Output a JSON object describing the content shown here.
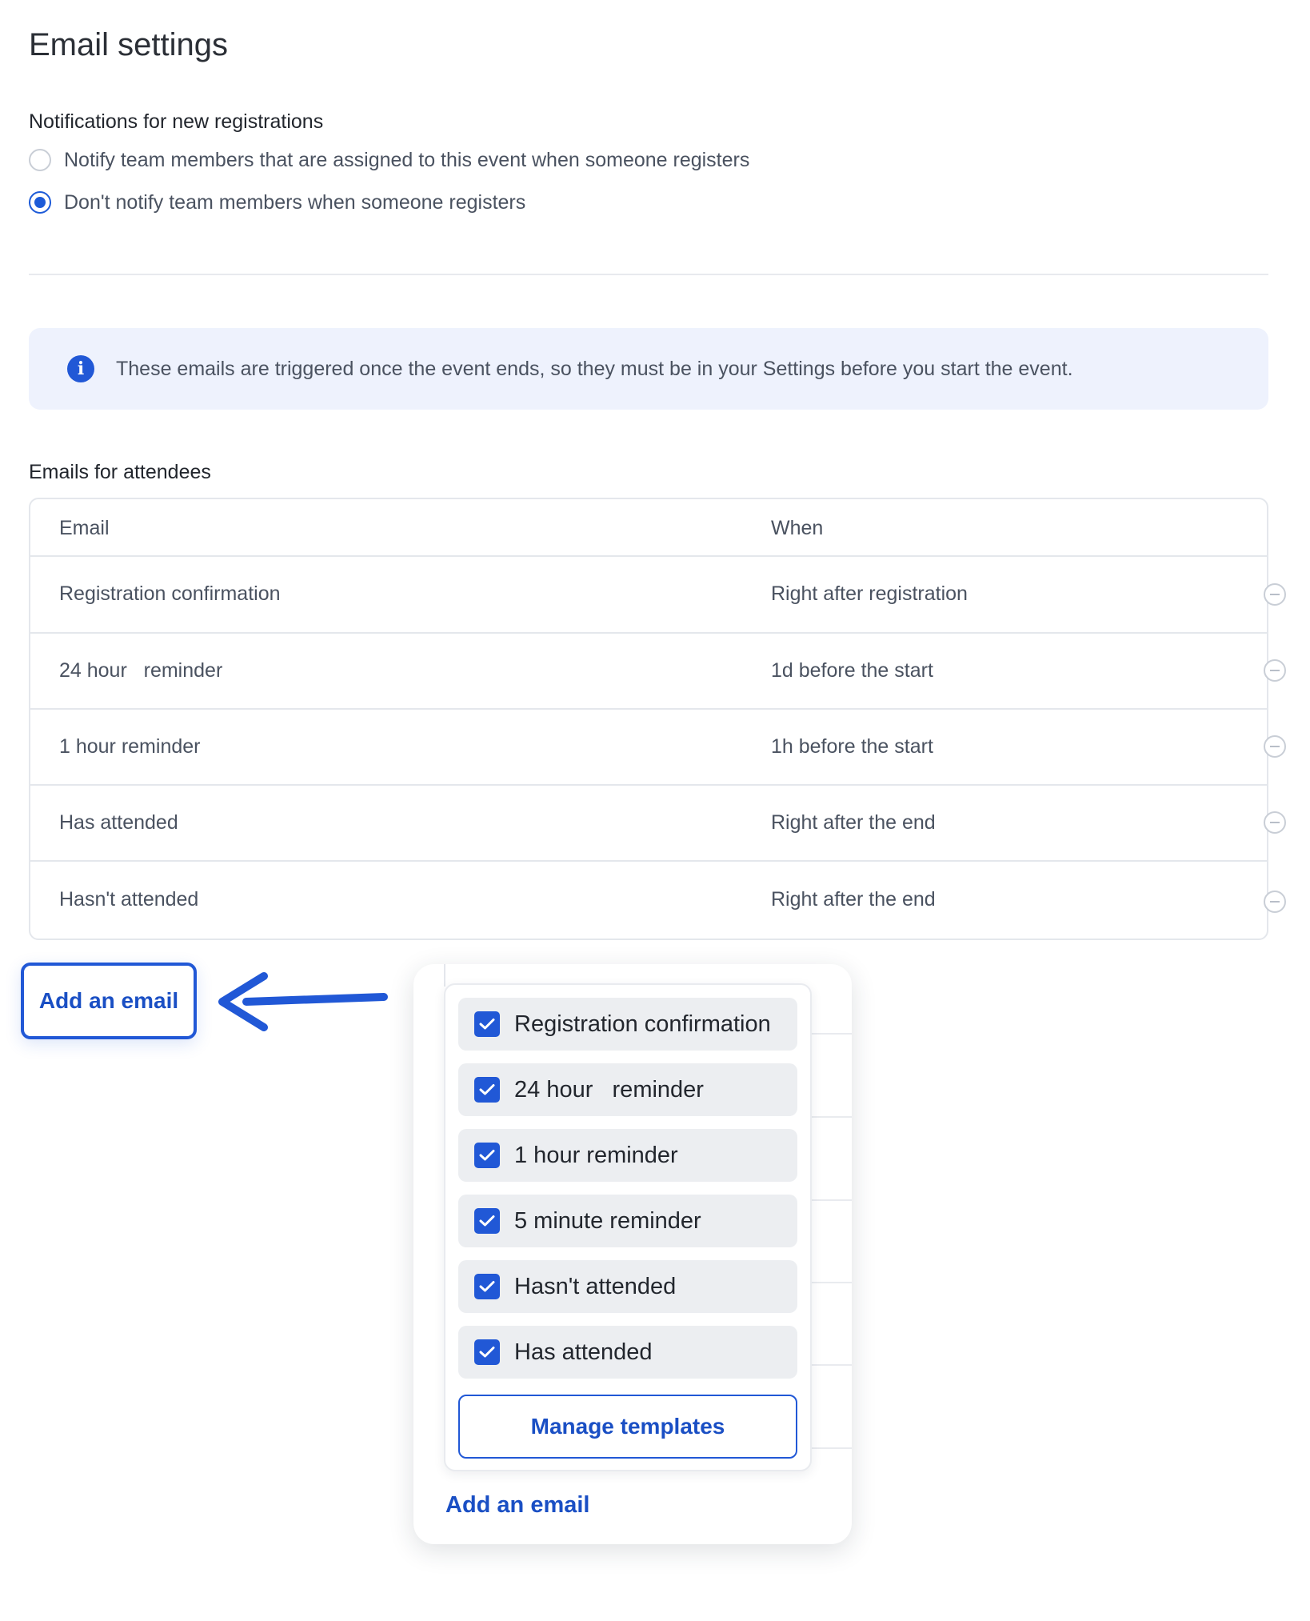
{
  "page": {
    "title": "Email settings"
  },
  "notifications": {
    "label": "Notifications for new registrations",
    "options": [
      {
        "label": "Notify team members that are assigned to this event when someone registers",
        "selected": false
      },
      {
        "label": "Don't notify team members when someone registers",
        "selected": true
      }
    ]
  },
  "info_banner": {
    "icon": "info-icon",
    "text": "These emails are triggered once the event ends, so they must be in your Settings before you start the event."
  },
  "attendee_emails": {
    "label": "Emails for attendees",
    "columns": [
      "Email",
      "When"
    ],
    "rows": [
      {
        "email": "Registration confirmation",
        "when": "Right after registration"
      },
      {
        "email": "24 hour   reminder",
        "when": "1d before the start"
      },
      {
        "email": "1 hour reminder",
        "when": "1h before the start"
      },
      {
        "email": "Has attended",
        "when": "Right after the end"
      },
      {
        "email": "Hasn't attended",
        "when": "Right after the end"
      }
    ],
    "add_email_label": "Add an email"
  },
  "popup": {
    "options": [
      {
        "label": "Registration confirmation",
        "checked": true
      },
      {
        "label": "24 hour   reminder",
        "checked": true
      },
      {
        "label": "1 hour reminder",
        "checked": true
      },
      {
        "label": "5 minute reminder",
        "checked": true
      },
      {
        "label": "Hasn't attended",
        "checked": true
      },
      {
        "label": "Has attended",
        "checked": true
      }
    ],
    "manage_label": "Manage templates",
    "add_email_label": "Add an email"
  },
  "colors": {
    "accent": "#2158d6",
    "banner_bg": "#eef2fd",
    "option_bg": "#eceef1"
  }
}
